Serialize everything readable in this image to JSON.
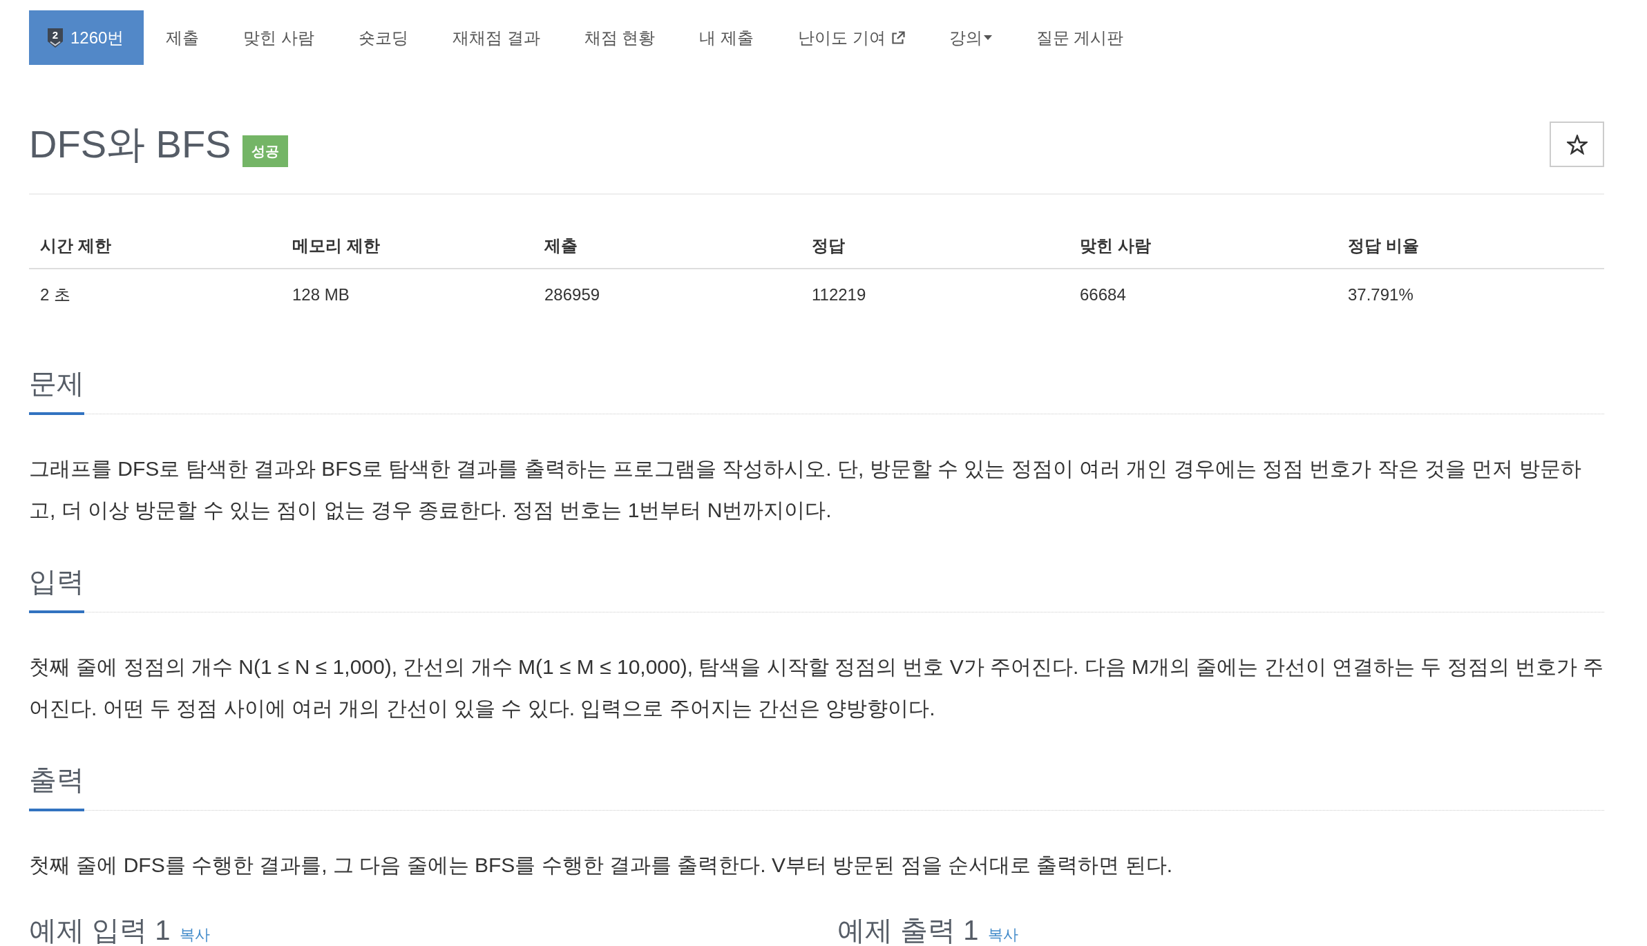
{
  "nav": {
    "tabs": [
      {
        "label": "1260번",
        "kind": "problem",
        "badge": "2",
        "selected": true
      },
      {
        "label": "제출",
        "kind": "plain",
        "selected": false
      },
      {
        "label": "맞힌 사람",
        "kind": "plain",
        "selected": false
      },
      {
        "label": "숏코딩",
        "kind": "plain",
        "selected": false
      },
      {
        "label": "재채점 결과",
        "kind": "plain",
        "selected": false
      },
      {
        "label": "채점 현황",
        "kind": "plain",
        "selected": false
      },
      {
        "label": "내 제출",
        "kind": "plain",
        "selected": false
      },
      {
        "label": "난이도 기여",
        "kind": "external",
        "selected": false
      },
      {
        "label": "강의",
        "kind": "dropdown",
        "selected": false
      },
      {
        "label": "질문 게시판",
        "kind": "plain",
        "selected": false
      }
    ]
  },
  "problem": {
    "title": "DFS와 BFS",
    "status_label": "성공"
  },
  "favorite": {
    "starred": false
  },
  "stats": {
    "columns": [
      "시간 제한",
      "메모리 제한",
      "제출",
      "정답",
      "맞힌 사람",
      "정답 비율"
    ],
    "rows": [
      [
        "2 초",
        "128 MB",
        "286959",
        "112219",
        "66684",
        "37.791%"
      ]
    ]
  },
  "sections": [
    {
      "heading": "문제",
      "text": "그래프를 DFS로 탐색한 결과와 BFS로 탐색한 결과를 출력하는 프로그램을 작성하시오. 단, 방문할 수 있는 정점이 여러 개인 경우에는 정점 번호가 작은 것을 먼저 방문하고, 더 이상 방문할 수 있는 점이 없는 경우 종료한다. 정점 번호는 1번부터 N번까지이다."
    },
    {
      "heading": "입력",
      "text": "첫째 줄에 정점의 개수 N(1 ≤ N ≤ 1,000), 간선의 개수 M(1 ≤ M ≤ 10,000), 탐색을 시작할 정점의 번호 V가 주어진다. 다음 M개의 줄에는 간선이 연결하는 두 정점의 번호가 주어진다. 어떤 두 정점 사이에 여러 개의 간선이 있을 수 있다. 입력으로 주어지는 간선은 양방향이다."
    },
    {
      "heading": "출력",
      "text": "첫째 줄에 DFS를 수행한 결과를, 그 다음 줄에는 BFS를 수행한 결과를 출력한다. V부터 방문된 점을 순서대로 출력하면 된다."
    }
  ],
  "samples": [
    {
      "heading": "예제 입력 1",
      "copy_link": "복사"
    },
    {
      "heading": "예제 출력 1",
      "copy_link": "복사"
    }
  ]
}
